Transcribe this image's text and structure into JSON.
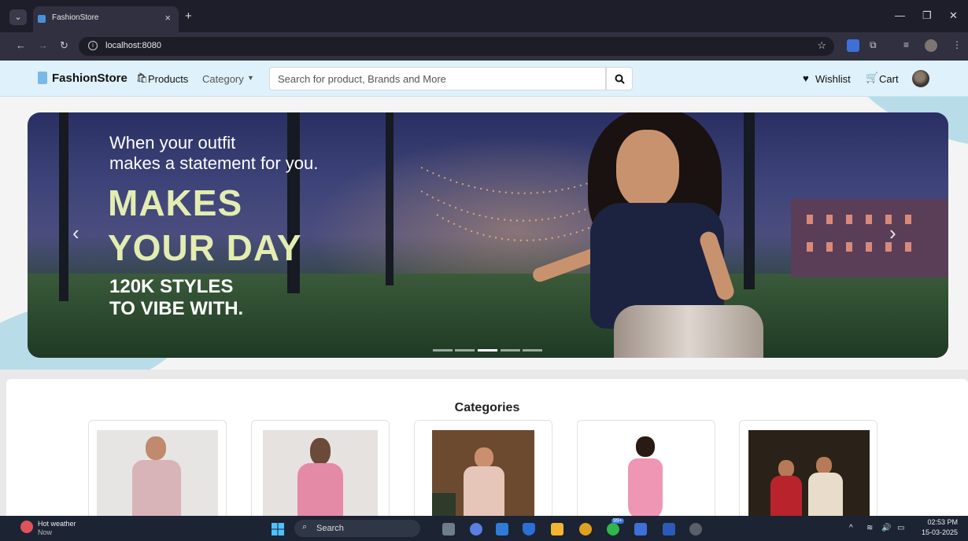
{
  "browser": {
    "tab_title": "FashionStore",
    "tab_close": "×",
    "new_tab": "+",
    "url": "localhost:8080"
  },
  "navbar": {
    "brand": "FashionStore",
    "products": "Products",
    "category": "Category",
    "search_placeholder": "Search for product, Brands and More",
    "wishlist": "Wishlist",
    "cart": "Cart"
  },
  "hero": {
    "line1": "When your outfit",
    "line2": "makes a statement for you.",
    "big1": "MAKES",
    "big2": "YOUR DAY",
    "small1": "120K STYLES",
    "small2": "TO VIBE WITH.",
    "slides_total": 5,
    "active_slide": 3
  },
  "categories": {
    "title": "Categories",
    "cards": [
      {
        "subject": "men"
      },
      {
        "subject": "women"
      },
      {
        "subject": "boys"
      },
      {
        "subject": "girls"
      },
      {
        "subject": "wedding"
      }
    ]
  },
  "taskbar": {
    "weather_title": "Hot weather",
    "weather_sub": "Now",
    "search": "Search",
    "badge": "99+",
    "time": "02:53 PM",
    "date": "15-03-2025"
  }
}
